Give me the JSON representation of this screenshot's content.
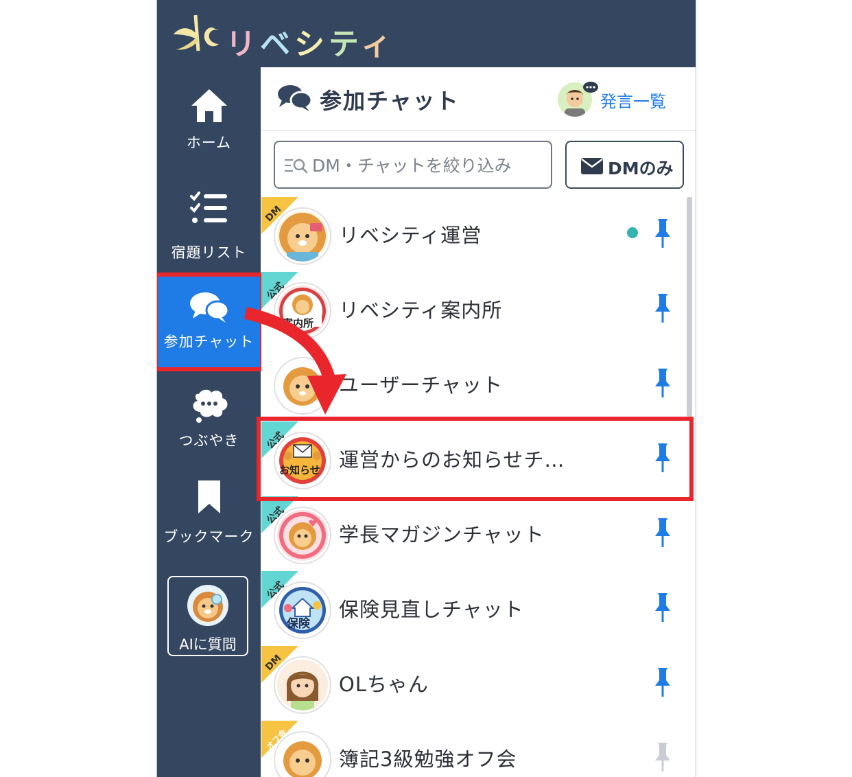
{
  "app": {
    "logo_text": [
      "リ",
      "ベ",
      "シ",
      "テ",
      "ィ"
    ]
  },
  "sidebar": {
    "items": [
      {
        "label": "ホーム",
        "icon": "home-icon"
      },
      {
        "label": "宿題リスト",
        "icon": "checklist-icon"
      },
      {
        "label": "参加チャット",
        "icon": "chat-bubbles-icon",
        "active": true
      },
      {
        "label": "つぶやき",
        "icon": "speech-bubble-icon"
      },
      {
        "label": "ブックマーク",
        "icon": "bookmark-icon"
      }
    ],
    "ai_button": {
      "label": "AIに質問"
    }
  },
  "header": {
    "title": "参加チャット",
    "link": "発言一覧"
  },
  "search": {
    "placeholder": "DM・チャットを絞り込み"
  },
  "dm_filter": {
    "label": "DMのみ"
  },
  "chats": [
    {
      "name": "リベシティ運営",
      "badge": "DM",
      "unread": true,
      "pinned": true
    },
    {
      "name": "リベシティ案内所",
      "badge": "公式",
      "icon_text": "案内所",
      "pinned": true
    },
    {
      "name": "ユーザーチャット",
      "badge": "",
      "pinned": true
    },
    {
      "name": "運営からのお知らせチ…",
      "badge": "公式",
      "icon_text": "お知らせ",
      "pinned": true
    },
    {
      "name": "学長マガジンチャット",
      "badge": "公式",
      "pinned": true
    },
    {
      "name": "保険見直しチャット",
      "badge": "公式",
      "icon_text": "保険",
      "pinned": true
    },
    {
      "name": "OLちゃん",
      "badge": "DM",
      "pinned": true
    },
    {
      "name": "簿記3級勉強オフ会",
      "badge": "オフ会",
      "pinned": false
    }
  ],
  "colors": {
    "nav_bg": "#354760",
    "active": "#1f7be6",
    "highlight": "#e8262c",
    "pin": "#1f7be6",
    "ribbon_dm": "#f6c343",
    "ribbon_official": "#62d6d2",
    "online_dot": "#35b3b0"
  }
}
